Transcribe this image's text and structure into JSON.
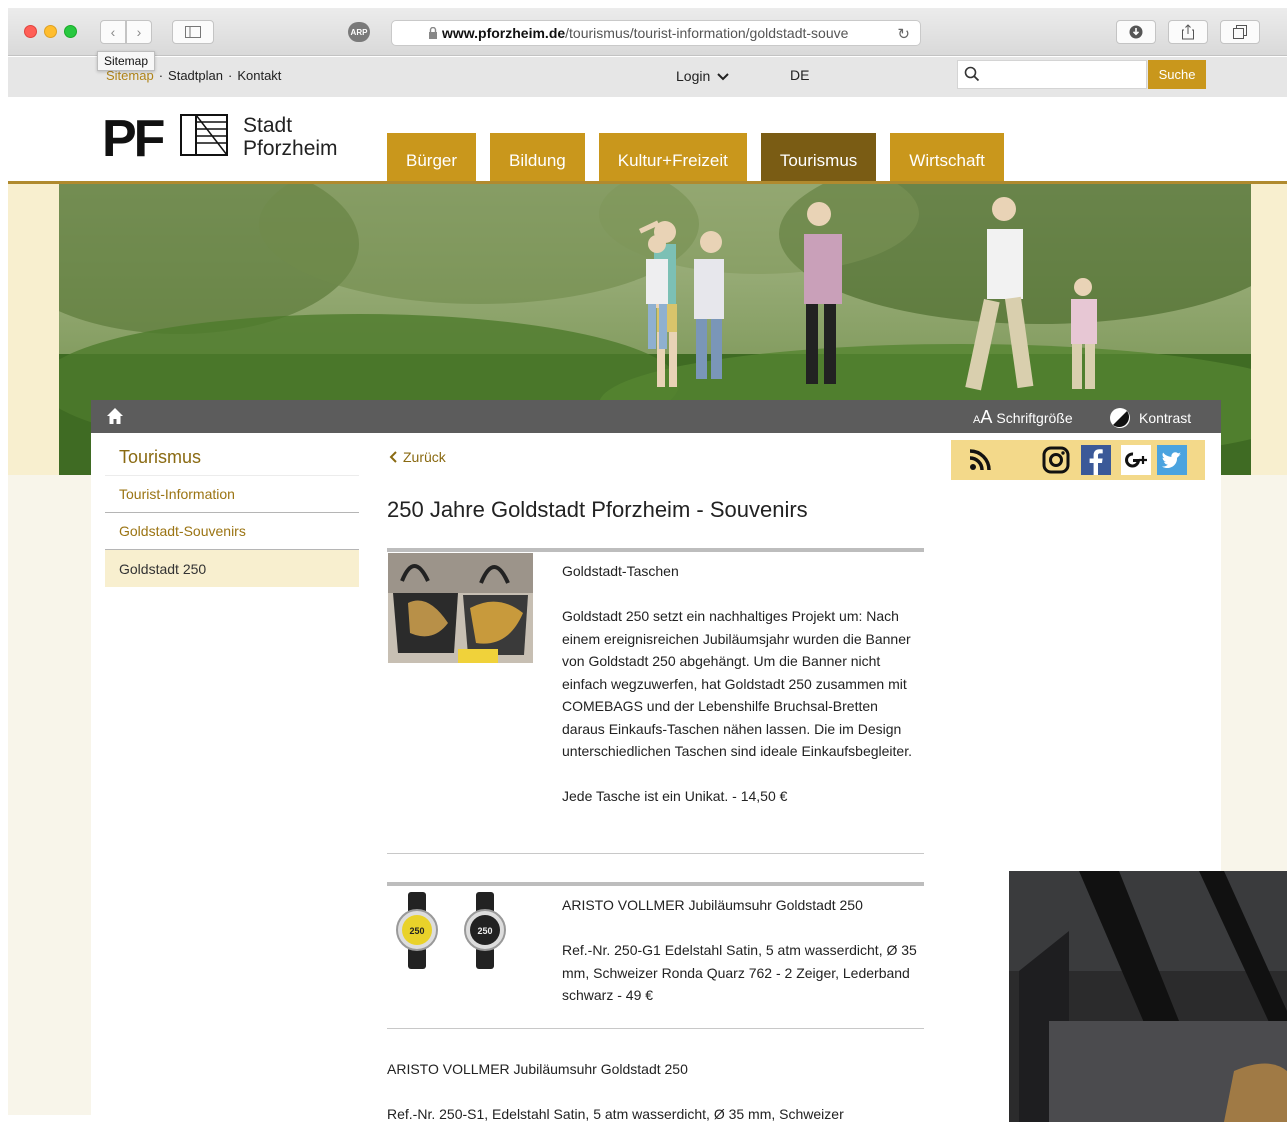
{
  "browser": {
    "url_host": "www.pforzheim.de",
    "url_path": "/tourismus/tourist-information/goldstadt-souve",
    "tooltip": "Sitemap",
    "arp_label": "ARP"
  },
  "topbar": {
    "links": [
      "Sitemap",
      "Stadtplan",
      "Kontakt"
    ],
    "login_label": "Login",
    "language": "DE",
    "search_placeholder": "",
    "search_button": "Suche"
  },
  "logo": {
    "letters": "PF",
    "line1": "Stadt",
    "line2": "Pforzheim"
  },
  "nav": {
    "items": [
      "Bürger",
      "Bildung",
      "Kultur+Freizeit",
      "Tourismus",
      "Wirtschaft"
    ],
    "active": "Tourismus"
  },
  "toolbar": {
    "font_small": "A",
    "font_big": "A",
    "font_label": "Schriftgröße",
    "contrast_label": "Kontrast"
  },
  "sidebar": {
    "title": "Tourismus",
    "items": [
      {
        "label": "Tourist-Information"
      },
      {
        "label": "Goldstadt-Souvenirs"
      },
      {
        "label": "Goldstadt 250"
      }
    ]
  },
  "main": {
    "back_label": "Zurück",
    "title": "250 Jahre Goldstadt Pforzheim - Souvenirs",
    "entries": [
      {
        "heading": "Goldstadt-Taschen",
        "body": "Goldstadt 250 setzt ein nachhaltiges Projekt um: Nach einem ereignisreichen Jubiläumsjahr wurden die Banner von Goldstadt 250 abgehängt. Um die Banner nicht einfach wegzuwerfen, hat Goldstadt 250 zusammen mit COMEBAGS und der Lebenshilfe Bruchsal-Bretten daraus Einkaufs-Taschen nähen lassen. Die im Design unterschiedlichen Taschen sind ideale Einkaufsbegleiter.",
        "price_line": "Jede Tasche ist ein Unikat. - 14,50 €"
      },
      {
        "heading": "ARISTO VOLLMER Jubiläumsuhr Goldstadt 250",
        "body": "Ref.-Nr. 250-G1 Edelstahl Satin, 5 atm wasserdicht, Ø 35 mm, Schweizer Ronda Quarz 762 - 2 Zeiger, Lederband schwarz - 49 €"
      },
      {
        "heading": "ARISTO VOLLMER Jubiläumsuhr Goldstadt 250",
        "body": "Ref.-Nr. 250-S1, Edelstahl Satin, 5 atm wasserdicht, Ø 35 mm, Schweizer"
      }
    ]
  },
  "colors": {
    "gold": "#c9971c",
    "gold_dark": "#7a5c14",
    "cream": "#f8efcf",
    "toolbar_grey": "#5c5c5c"
  },
  "icons": [
    "rss-icon",
    "instagram-icon",
    "facebook-icon",
    "google-plus-icon",
    "twitter-icon",
    "home-icon",
    "contrast-icon",
    "search-icon"
  ]
}
